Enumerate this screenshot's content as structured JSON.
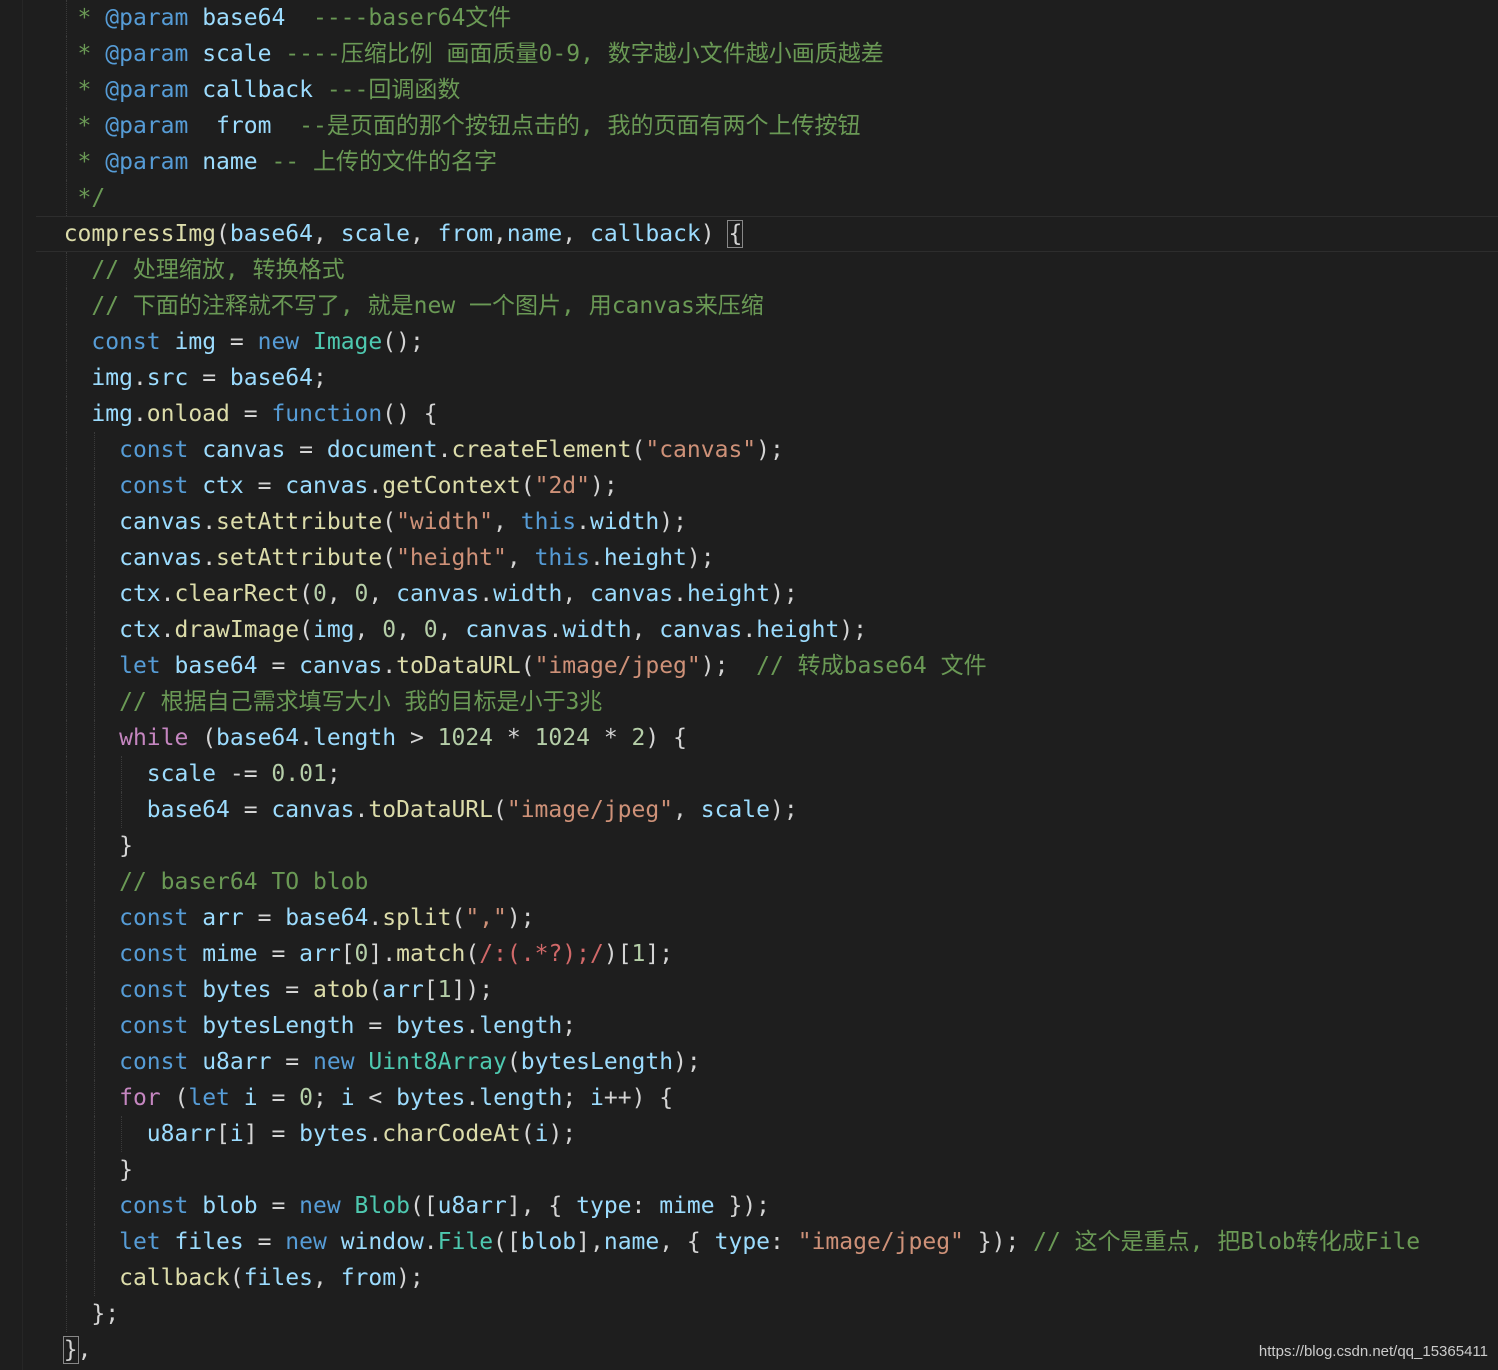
{
  "watermark": "https://blog.csdn.net/qq_15365411",
  "lines": [
    [
      [
        "   ",
        "plain"
      ],
      [
        "* ",
        "comment"
      ],
      [
        "@param",
        "tag"
      ],
      [
        " ",
        "plain"
      ],
      [
        "base64",
        "var"
      ],
      [
        "  ----baser64文件",
        "comment"
      ]
    ],
    [
      [
        "   ",
        "plain"
      ],
      [
        "* ",
        "comment"
      ],
      [
        "@param",
        "tag"
      ],
      [
        " ",
        "plain"
      ],
      [
        "scale",
        "var"
      ],
      [
        " ----压缩比例 画面质量0-9, 数字越小文件越小画质越差",
        "comment"
      ]
    ],
    [
      [
        "   ",
        "plain"
      ],
      [
        "* ",
        "comment"
      ],
      [
        "@param",
        "tag"
      ],
      [
        " ",
        "plain"
      ],
      [
        "callback",
        "var"
      ],
      [
        " ---回调函数",
        "comment"
      ]
    ],
    [
      [
        "   ",
        "plain"
      ],
      [
        "* ",
        "comment"
      ],
      [
        "@param",
        "tag"
      ],
      [
        "  ",
        "plain"
      ],
      [
        "from",
        "var"
      ],
      [
        "  --是页面的那个按钮点击的, 我的页面有两个上传按钮",
        "comment"
      ]
    ],
    [
      [
        "   ",
        "plain"
      ],
      [
        "* ",
        "comment"
      ],
      [
        "@param",
        "tag"
      ],
      [
        " ",
        "plain"
      ],
      [
        "name",
        "var"
      ],
      [
        " -- 上传的文件的名字",
        "comment"
      ]
    ],
    [
      [
        "   ",
        "plain"
      ],
      [
        "*/",
        "comment"
      ]
    ],
    [
      [
        "  ",
        "plain"
      ],
      [
        "compressImg",
        "fn"
      ],
      [
        "(",
        "plain"
      ],
      [
        "base64",
        "var"
      ],
      [
        ", ",
        "plain"
      ],
      [
        "scale",
        "var"
      ],
      [
        ", ",
        "plain"
      ],
      [
        "from",
        "var"
      ],
      [
        ",",
        "plain"
      ],
      [
        "name",
        "var"
      ],
      [
        ", ",
        "plain"
      ],
      [
        "callback",
        "var"
      ],
      [
        ") ",
        "plain"
      ],
      [
        "{",
        "bracket"
      ]
    ],
    [
      [
        "    ",
        "plain"
      ],
      [
        "// 处理缩放, 转换格式",
        "comment"
      ]
    ],
    [
      [
        "    ",
        "plain"
      ],
      [
        "// 下面的注释就不写了, 就是new 一个图片, 用canvas来压缩",
        "comment"
      ]
    ],
    [
      [
        "    ",
        "plain"
      ],
      [
        "const",
        "keyword"
      ],
      [
        " ",
        "plain"
      ],
      [
        "img",
        "var"
      ],
      [
        " = ",
        "plain"
      ],
      [
        "new",
        "keyword"
      ],
      [
        " ",
        "plain"
      ],
      [
        "Image",
        "class"
      ],
      [
        "();",
        "plain"
      ]
    ],
    [
      [
        "    ",
        "plain"
      ],
      [
        "img",
        "var"
      ],
      [
        ".",
        "plain"
      ],
      [
        "src",
        "var"
      ],
      [
        " = ",
        "plain"
      ],
      [
        "base64",
        "var"
      ],
      [
        ";",
        "plain"
      ]
    ],
    [
      [
        "    ",
        "plain"
      ],
      [
        "img",
        "var"
      ],
      [
        ".",
        "plain"
      ],
      [
        "onload",
        "fn"
      ],
      [
        " = ",
        "plain"
      ],
      [
        "function",
        "keyword"
      ],
      [
        "() {",
        "plain"
      ]
    ],
    [
      [
        "      ",
        "plain"
      ],
      [
        "const",
        "keyword"
      ],
      [
        " ",
        "plain"
      ],
      [
        "canvas",
        "var"
      ],
      [
        " = ",
        "plain"
      ],
      [
        "document",
        "var"
      ],
      [
        ".",
        "plain"
      ],
      [
        "createElement",
        "fn"
      ],
      [
        "(",
        "plain"
      ],
      [
        "\"canvas\"",
        "string"
      ],
      [
        ");",
        "plain"
      ]
    ],
    [
      [
        "      ",
        "plain"
      ],
      [
        "const",
        "keyword"
      ],
      [
        " ",
        "plain"
      ],
      [
        "ctx",
        "var"
      ],
      [
        " = ",
        "plain"
      ],
      [
        "canvas",
        "var"
      ],
      [
        ".",
        "plain"
      ],
      [
        "getContext",
        "fn"
      ],
      [
        "(",
        "plain"
      ],
      [
        "\"2d\"",
        "string"
      ],
      [
        ");",
        "plain"
      ]
    ],
    [
      [
        "      ",
        "plain"
      ],
      [
        "canvas",
        "var"
      ],
      [
        ".",
        "plain"
      ],
      [
        "setAttribute",
        "fn"
      ],
      [
        "(",
        "plain"
      ],
      [
        "\"width\"",
        "string"
      ],
      [
        ", ",
        "plain"
      ],
      [
        "this",
        "keyword"
      ],
      [
        ".",
        "plain"
      ],
      [
        "width",
        "var"
      ],
      [
        ");",
        "plain"
      ]
    ],
    [
      [
        "      ",
        "plain"
      ],
      [
        "canvas",
        "var"
      ],
      [
        ".",
        "plain"
      ],
      [
        "setAttribute",
        "fn"
      ],
      [
        "(",
        "plain"
      ],
      [
        "\"height\"",
        "string"
      ],
      [
        ", ",
        "plain"
      ],
      [
        "this",
        "keyword"
      ],
      [
        ".",
        "plain"
      ],
      [
        "height",
        "var"
      ],
      [
        ");",
        "plain"
      ]
    ],
    [
      [
        "      ",
        "plain"
      ],
      [
        "ctx",
        "var"
      ],
      [
        ".",
        "plain"
      ],
      [
        "clearRect",
        "fn"
      ],
      [
        "(",
        "plain"
      ],
      [
        "0",
        "number"
      ],
      [
        ", ",
        "plain"
      ],
      [
        "0",
        "number"
      ],
      [
        ", ",
        "plain"
      ],
      [
        "canvas",
        "var"
      ],
      [
        ".",
        "plain"
      ],
      [
        "width",
        "var"
      ],
      [
        ", ",
        "plain"
      ],
      [
        "canvas",
        "var"
      ],
      [
        ".",
        "plain"
      ],
      [
        "height",
        "var"
      ],
      [
        ");",
        "plain"
      ]
    ],
    [
      [
        "      ",
        "plain"
      ],
      [
        "ctx",
        "var"
      ],
      [
        ".",
        "plain"
      ],
      [
        "drawImage",
        "fn"
      ],
      [
        "(",
        "plain"
      ],
      [
        "img",
        "var"
      ],
      [
        ", ",
        "plain"
      ],
      [
        "0",
        "number"
      ],
      [
        ", ",
        "plain"
      ],
      [
        "0",
        "number"
      ],
      [
        ", ",
        "plain"
      ],
      [
        "canvas",
        "var"
      ],
      [
        ".",
        "plain"
      ],
      [
        "width",
        "var"
      ],
      [
        ", ",
        "plain"
      ],
      [
        "canvas",
        "var"
      ],
      [
        ".",
        "plain"
      ],
      [
        "height",
        "var"
      ],
      [
        ");",
        "plain"
      ]
    ],
    [
      [
        "      ",
        "plain"
      ],
      [
        "let",
        "keyword"
      ],
      [
        " ",
        "plain"
      ],
      [
        "base64",
        "var"
      ],
      [
        " = ",
        "plain"
      ],
      [
        "canvas",
        "var"
      ],
      [
        ".",
        "plain"
      ],
      [
        "toDataURL",
        "fn"
      ],
      [
        "(",
        "plain"
      ],
      [
        "\"image/jpeg\"",
        "string"
      ],
      [
        ");  ",
        "plain"
      ],
      [
        "// 转成base64 文件",
        "comment"
      ]
    ],
    [
      [
        "      ",
        "plain"
      ],
      [
        "// 根据自己需求填写大小 我的目标是小于3兆",
        "comment"
      ]
    ],
    [
      [
        "      ",
        "plain"
      ],
      [
        "while",
        "control"
      ],
      [
        " (",
        "plain"
      ],
      [
        "base64",
        "var"
      ],
      [
        ".",
        "plain"
      ],
      [
        "length",
        "var"
      ],
      [
        " > ",
        "plain"
      ],
      [
        "1024",
        "number"
      ],
      [
        " * ",
        "plain"
      ],
      [
        "1024",
        "number"
      ],
      [
        " * ",
        "plain"
      ],
      [
        "2",
        "number"
      ],
      [
        ") {",
        "plain"
      ]
    ],
    [
      [
        "        ",
        "plain"
      ],
      [
        "scale",
        "var"
      ],
      [
        " -= ",
        "plain"
      ],
      [
        "0.01",
        "number"
      ],
      [
        ";",
        "plain"
      ]
    ],
    [
      [
        "        ",
        "plain"
      ],
      [
        "base64",
        "var"
      ],
      [
        " = ",
        "plain"
      ],
      [
        "canvas",
        "var"
      ],
      [
        ".",
        "plain"
      ],
      [
        "toDataURL",
        "fn"
      ],
      [
        "(",
        "plain"
      ],
      [
        "\"image/jpeg\"",
        "string"
      ],
      [
        ", ",
        "plain"
      ],
      [
        "scale",
        "var"
      ],
      [
        ");",
        "plain"
      ]
    ],
    [
      [
        "      ",
        "plain"
      ],
      [
        "}",
        "plain"
      ]
    ],
    [
      [
        "      ",
        "plain"
      ],
      [
        "// baser64 TO blob",
        "comment"
      ]
    ],
    [
      [
        "      ",
        "plain"
      ],
      [
        "const",
        "keyword"
      ],
      [
        " ",
        "plain"
      ],
      [
        "arr",
        "var"
      ],
      [
        " = ",
        "plain"
      ],
      [
        "base64",
        "var"
      ],
      [
        ".",
        "plain"
      ],
      [
        "split",
        "fn"
      ],
      [
        "(",
        "plain"
      ],
      [
        "\",\"",
        "string"
      ],
      [
        ");",
        "plain"
      ]
    ],
    [
      [
        "      ",
        "plain"
      ],
      [
        "const",
        "keyword"
      ],
      [
        " ",
        "plain"
      ],
      [
        "mime",
        "var"
      ],
      [
        " = ",
        "plain"
      ],
      [
        "arr",
        "var"
      ],
      [
        "[",
        "plain"
      ],
      [
        "0",
        "number"
      ],
      [
        "].",
        "plain"
      ],
      [
        "match",
        "fn"
      ],
      [
        "(",
        "plain"
      ],
      [
        "/:(.*?);/",
        "regex"
      ],
      [
        ")[",
        "plain"
      ],
      [
        "1",
        "number"
      ],
      [
        "];",
        "plain"
      ]
    ],
    [
      [
        "      ",
        "plain"
      ],
      [
        "const",
        "keyword"
      ],
      [
        " ",
        "plain"
      ],
      [
        "bytes",
        "var"
      ],
      [
        " = ",
        "plain"
      ],
      [
        "atob",
        "fn"
      ],
      [
        "(",
        "plain"
      ],
      [
        "arr",
        "var"
      ],
      [
        "[",
        "plain"
      ],
      [
        "1",
        "number"
      ],
      [
        "]);",
        "plain"
      ]
    ],
    [
      [
        "      ",
        "plain"
      ],
      [
        "const",
        "keyword"
      ],
      [
        " ",
        "plain"
      ],
      [
        "bytesLength",
        "var"
      ],
      [
        " = ",
        "plain"
      ],
      [
        "bytes",
        "var"
      ],
      [
        ".",
        "plain"
      ],
      [
        "length",
        "var"
      ],
      [
        ";",
        "plain"
      ]
    ],
    [
      [
        "      ",
        "plain"
      ],
      [
        "const",
        "keyword"
      ],
      [
        " ",
        "plain"
      ],
      [
        "u8arr",
        "var"
      ],
      [
        " = ",
        "plain"
      ],
      [
        "new",
        "keyword"
      ],
      [
        " ",
        "plain"
      ],
      [
        "Uint8Array",
        "class"
      ],
      [
        "(",
        "plain"
      ],
      [
        "bytesLength",
        "var"
      ],
      [
        ");",
        "plain"
      ]
    ],
    [
      [
        "      ",
        "plain"
      ],
      [
        "for",
        "control"
      ],
      [
        " (",
        "plain"
      ],
      [
        "let",
        "keyword"
      ],
      [
        " ",
        "plain"
      ],
      [
        "i",
        "var"
      ],
      [
        " = ",
        "plain"
      ],
      [
        "0",
        "number"
      ],
      [
        "; ",
        "plain"
      ],
      [
        "i",
        "var"
      ],
      [
        " < ",
        "plain"
      ],
      [
        "bytes",
        "var"
      ],
      [
        ".",
        "plain"
      ],
      [
        "length",
        "var"
      ],
      [
        "; ",
        "plain"
      ],
      [
        "i",
        "var"
      ],
      [
        "++) {",
        "plain"
      ]
    ],
    [
      [
        "        ",
        "plain"
      ],
      [
        "u8arr",
        "var"
      ],
      [
        "[",
        "plain"
      ],
      [
        "i",
        "var"
      ],
      [
        "] = ",
        "plain"
      ],
      [
        "bytes",
        "var"
      ],
      [
        ".",
        "plain"
      ],
      [
        "charCodeAt",
        "fn"
      ],
      [
        "(",
        "plain"
      ],
      [
        "i",
        "var"
      ],
      [
        ");",
        "plain"
      ]
    ],
    [
      [
        "      ",
        "plain"
      ],
      [
        "}",
        "plain"
      ]
    ],
    [
      [
        "      ",
        "plain"
      ],
      [
        "const",
        "keyword"
      ],
      [
        " ",
        "plain"
      ],
      [
        "blob",
        "var"
      ],
      [
        " = ",
        "plain"
      ],
      [
        "new",
        "keyword"
      ],
      [
        " ",
        "plain"
      ],
      [
        "Blob",
        "class"
      ],
      [
        "([",
        "plain"
      ],
      [
        "u8arr",
        "var"
      ],
      [
        "], { ",
        "plain"
      ],
      [
        "type",
        "var"
      ],
      [
        ": ",
        "plain"
      ],
      [
        "mime",
        "var"
      ],
      [
        " });",
        "plain"
      ]
    ],
    [
      [
        "      ",
        "plain"
      ],
      [
        "let",
        "keyword"
      ],
      [
        " ",
        "plain"
      ],
      [
        "files",
        "var"
      ],
      [
        " = ",
        "plain"
      ],
      [
        "new",
        "keyword"
      ],
      [
        " ",
        "plain"
      ],
      [
        "window",
        "var"
      ],
      [
        ".",
        "plain"
      ],
      [
        "File",
        "class"
      ],
      [
        "([",
        "plain"
      ],
      [
        "blob",
        "var"
      ],
      [
        "],",
        "plain"
      ],
      [
        "name",
        "var"
      ],
      [
        ", { ",
        "plain"
      ],
      [
        "type",
        "var"
      ],
      [
        ": ",
        "plain"
      ],
      [
        "\"image/jpeg\"",
        "string"
      ],
      [
        " }); ",
        "plain"
      ],
      [
        "// 这个是重点, 把Blob转化成File",
        "comment"
      ]
    ],
    [
      [
        "      ",
        "plain"
      ],
      [
        "callback",
        "fn"
      ],
      [
        "(",
        "plain"
      ],
      [
        "files",
        "var"
      ],
      [
        ", ",
        "plain"
      ],
      [
        "from",
        "var"
      ],
      [
        ");",
        "plain"
      ]
    ],
    [
      [
        "    ",
        "plain"
      ],
      [
        "};",
        "plain"
      ]
    ],
    [
      [
        "  ",
        "plain"
      ],
      [
        "}",
        "bracket"
      ],
      [
        ",",
        "plain"
      ]
    ]
  ]
}
